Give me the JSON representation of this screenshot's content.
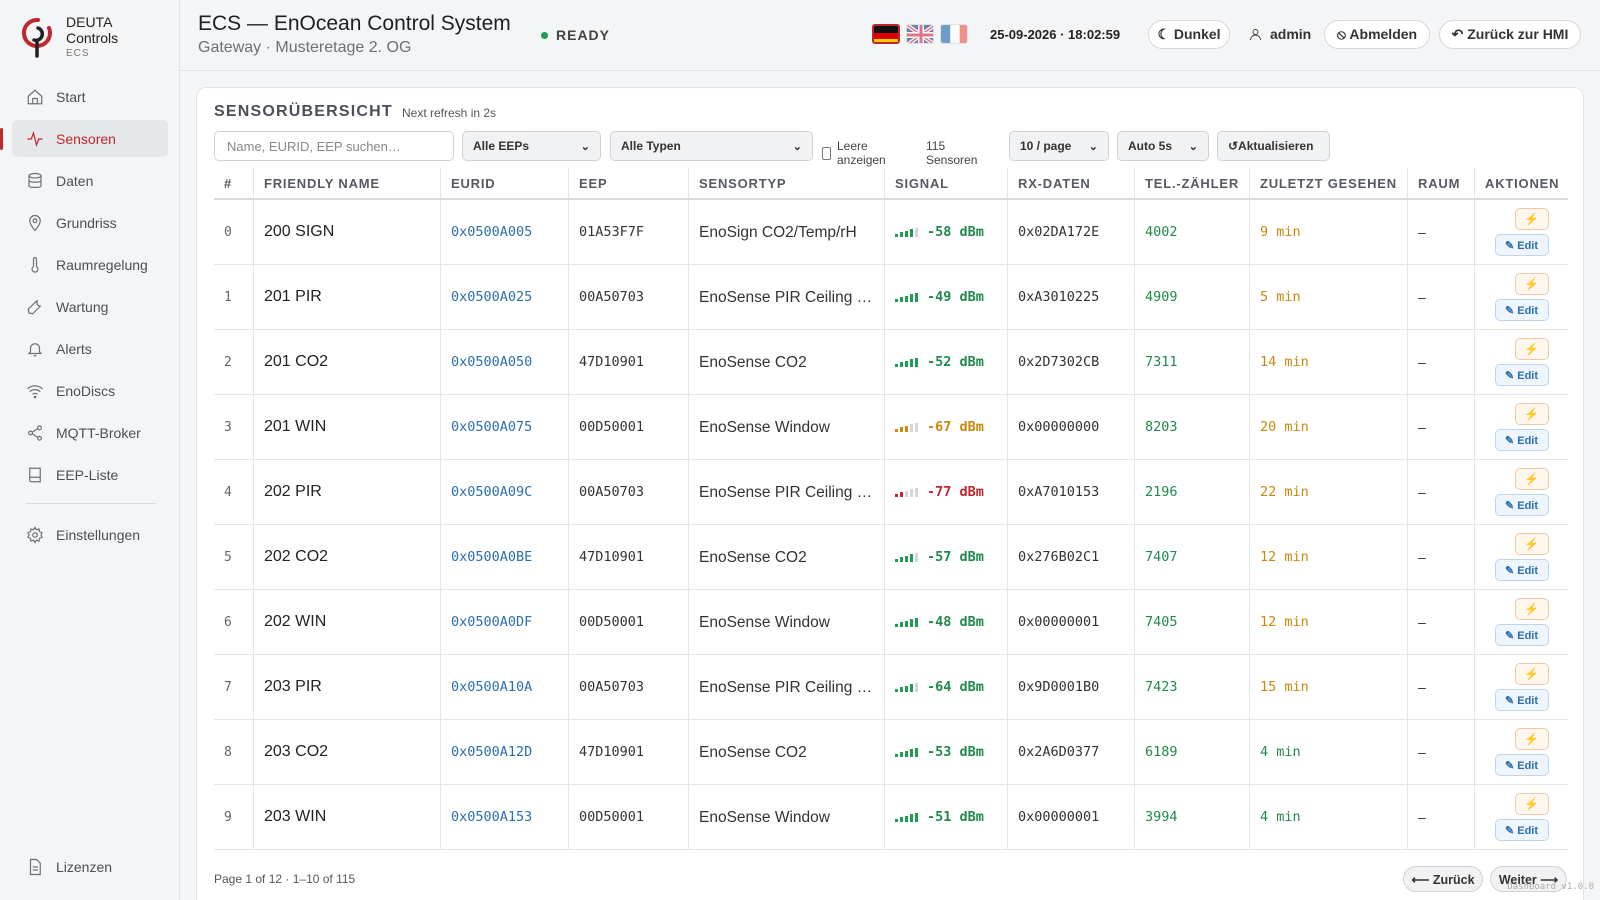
{
  "brand": {
    "line1": "DEUTA",
    "line2": "Controls",
    "line3": "ECS"
  },
  "nav": [
    {
      "label": "Start",
      "icon": "home-icon"
    },
    {
      "label": "Sensoren",
      "icon": "activity-icon",
      "active": true
    },
    {
      "label": "Daten",
      "icon": "database-icon"
    },
    {
      "label": "Grundriss",
      "icon": "map-pin-icon"
    },
    {
      "label": "Raumregelung",
      "icon": "thermometer-icon"
    },
    {
      "label": "Wartung",
      "icon": "wrench-icon"
    },
    {
      "label": "Alerts",
      "icon": "bell-icon"
    },
    {
      "label": "EnoDiscs",
      "icon": "wifi-icon"
    },
    {
      "label": "MQTT-Broker",
      "icon": "share-icon"
    },
    {
      "label": "EEP-Liste",
      "icon": "book-icon"
    },
    {
      "label": "Einstellungen",
      "icon": "gear-icon"
    }
  ],
  "nav_bottom": {
    "label": "Lizenzen",
    "icon": "document-icon"
  },
  "header": {
    "title": "ECS — EnOcean Control System",
    "subtitle": "Gateway · Musteretage 2. OG",
    "status": "READY",
    "datetime": "25-09-2026 · 18:02:59",
    "theme_button": "☾ Dunkel",
    "user": "admin",
    "logout_button": "⦸ Abmelden",
    "back_button": "↶ Zurück zur HMI",
    "languages": [
      "de",
      "en",
      "fr"
    ],
    "selected_language": "de"
  },
  "card": {
    "title": "SENSORÜBERSICHT",
    "refresh": "Next refresh in 2s",
    "search_placeholder": "Name, EURID, EEP suchen…",
    "eep_filter": "Alle EEPs",
    "type_filter": "Alle Typen",
    "show_empty_label": "Leere anzeigen",
    "sensor_count": "115 Sensoren",
    "page_size": "10 / page",
    "auto_refresh": "Auto 5s",
    "refresh_button": "↺Aktualisieren"
  },
  "table": {
    "columns": [
      "#",
      "FRIENDLY NAME",
      "EURID",
      "EEP",
      "SENSORTYP",
      "SIGNAL",
      "RX-DATEN",
      "TEL.-ZÄHLER",
      "ZULETZT GESEHEN",
      "RAUM",
      "AKTIONEN"
    ],
    "edit_label": "✎ Edit",
    "action_icon": "⚡",
    "rows": [
      {
        "idx": "0",
        "name": "200 SIGN",
        "eurid": "0x0500A005",
        "eep": "01A53F7F",
        "type": "EnoSign CO2/Temp/rH",
        "signal": "-58 dBm",
        "bars": 4,
        "level": "good",
        "rx": "0x02DA172E",
        "tel": "4002",
        "seen": "9 min",
        "seen_level": "warn",
        "room": "–"
      },
      {
        "idx": "1",
        "name": "201 PIR",
        "eurid": "0x0500A025",
        "eep": "00A50703",
        "type": "EnoSense PIR Ceiling Mount",
        "signal": "-49 dBm",
        "bars": 5,
        "level": "good",
        "rx": "0xA3010225",
        "tel": "4909",
        "seen": "5 min",
        "seen_level": "warn",
        "room": "–"
      },
      {
        "idx": "2",
        "name": "201 CO2",
        "eurid": "0x0500A050",
        "eep": "47D10901",
        "type": "EnoSense CO2",
        "signal": "-52 dBm",
        "bars": 5,
        "level": "good",
        "rx": "0x2D7302CB",
        "tel": "7311",
        "seen": "14 min",
        "seen_level": "warn",
        "room": "–"
      },
      {
        "idx": "3",
        "name": "201 WIN",
        "eurid": "0x0500A075",
        "eep": "00D50001",
        "type": "EnoSense Window",
        "signal": "-67 dBm",
        "bars": 3,
        "level": "warn",
        "rx": "0x00000000",
        "tel": "8203",
        "seen": "20 min",
        "seen_level": "warn",
        "room": "–"
      },
      {
        "idx": "4",
        "name": "202 PIR",
        "eurid": "0x0500A09C",
        "eep": "00A50703",
        "type": "EnoSense PIR Ceiling Mount",
        "signal": "-77 dBm",
        "bars": 2,
        "level": "bad",
        "rx": "0xA7010153",
        "tel": "2196",
        "seen": "22 min",
        "seen_level": "warn",
        "room": "–"
      },
      {
        "idx": "5",
        "name": "202 CO2",
        "eurid": "0x0500A0BE",
        "eep": "47D10901",
        "type": "EnoSense CO2",
        "signal": "-57 dBm",
        "bars": 4,
        "level": "good",
        "rx": "0x276B02C1",
        "tel": "7407",
        "seen": "12 min",
        "seen_level": "warn",
        "room": "–"
      },
      {
        "idx": "6",
        "name": "202 WIN",
        "eurid": "0x0500A0DF",
        "eep": "00D50001",
        "type": "EnoSense Window",
        "signal": "-48 dBm",
        "bars": 5,
        "level": "good",
        "rx": "0x00000001",
        "tel": "7405",
        "seen": "12 min",
        "seen_level": "warn",
        "room": "–"
      },
      {
        "idx": "7",
        "name": "203 PIR",
        "eurid": "0x0500A10A",
        "eep": "00A50703",
        "type": "EnoSense PIR Ceiling Mount",
        "signal": "-64 dBm",
        "bars": 4,
        "level": "good",
        "rx": "0x9D0001B0",
        "tel": "7423",
        "seen": "15 min",
        "seen_level": "warn",
        "room": "–"
      },
      {
        "idx": "8",
        "name": "203 CO2",
        "eurid": "0x0500A12D",
        "eep": "47D10901",
        "type": "EnoSense CO2",
        "signal": "-53 dBm",
        "bars": 5,
        "level": "good",
        "rx": "0x2A6D0377",
        "tel": "6189",
        "seen": "4 min",
        "seen_level": "good",
        "room": "–"
      },
      {
        "idx": "9",
        "name": "203 WIN",
        "eurid": "0x0500A153",
        "eep": "00D50001",
        "type": "EnoSense Window",
        "signal": "-51 dBm",
        "bars": 5,
        "level": "good",
        "rx": "0x00000001",
        "tel": "3994",
        "seen": "4 min",
        "seen_level": "good",
        "room": "–"
      }
    ]
  },
  "footer": {
    "page_info": "Page 1 of 12 · 1–10 of 115",
    "prev_button": "⟵ Zurück",
    "next_button": "Weiter ⟶",
    "version": "Dashboard v1.0.0"
  },
  "colors": {
    "accent": "#c0262d",
    "good": "#1f8a4c",
    "warn": "#c9880c",
    "link": "#2c6fb0"
  }
}
